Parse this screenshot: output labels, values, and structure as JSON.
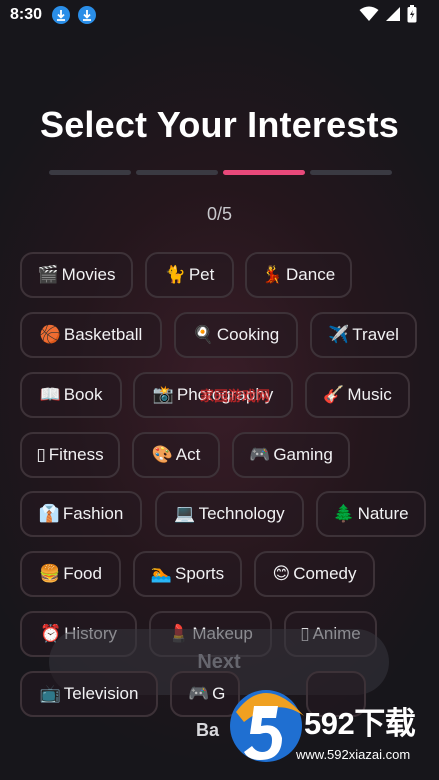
{
  "status_bar": {
    "time": "8:30",
    "icons": [
      "download-icon",
      "download-icon",
      "wifi-icon",
      "battery-icon"
    ]
  },
  "header": {
    "title": "Select Your Interests",
    "progress": {
      "steps": 4,
      "current_step": 3
    },
    "counter": "0/5"
  },
  "interests": [
    {
      "emoji": "🎬",
      "label": "Movies"
    },
    {
      "emoji": "🐈",
      "label": "Pet"
    },
    {
      "emoji": "💃",
      "label": "Dance"
    },
    {
      "emoji": "🏀",
      "label": "Basketball"
    },
    {
      "emoji": "🍳",
      "label": "Cooking"
    },
    {
      "emoji": "✈️",
      "label": "Travel"
    },
    {
      "emoji": "📖",
      "label": "Book"
    },
    {
      "emoji": "📸",
      "label": "Photography"
    },
    {
      "emoji": "🎸",
      "label": "Music"
    },
    {
      "emoji": "▯",
      "label": "Fitness"
    },
    {
      "emoji": "🎨",
      "label": "Act"
    },
    {
      "emoji": "🎮",
      "label": "Gaming"
    },
    {
      "emoji": "👔",
      "label": "Fashion"
    },
    {
      "emoji": "💻",
      "label": "Technology"
    },
    {
      "emoji": "🌲",
      "label": "Nature"
    },
    {
      "emoji": "🍔",
      "label": "Food"
    },
    {
      "emoji": "🏊",
      "label": "Sports"
    },
    {
      "emoji": "😊",
      "label": "Comedy"
    },
    {
      "emoji": "⏰",
      "label": "History"
    },
    {
      "emoji": "💄",
      "label": "Makeup"
    },
    {
      "emoji": "▯",
      "label": "Anime"
    },
    {
      "emoji": "📺",
      "label": "Television"
    },
    {
      "emoji": "🎮",
      "label": "G"
    }
  ],
  "footer": {
    "next_label": "Next",
    "back_label": "Ba"
  },
  "watermark": {
    "center_text": "家园游戏网",
    "brand": "592下载",
    "url": "www.592xiazai.com"
  },
  "colors": {
    "accent": "#e8497a",
    "background": "#1c1a1f",
    "chip_border": "#3d3238"
  }
}
